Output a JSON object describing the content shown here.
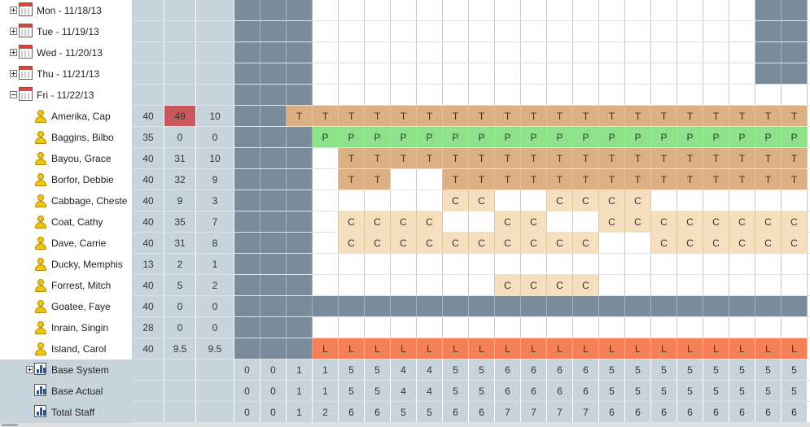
{
  "rows": [
    {
      "type": "day",
      "label": "Mon - 11/18/13",
      "expander": "plus",
      "cells": [
        "g",
        "g",
        "g",
        "",
        "",
        "",
        "",
        "",
        "",
        "",
        "",
        "",
        "",
        "",
        "",
        "",
        "",
        "",
        "",
        "",
        "g",
        "g"
      ]
    },
    {
      "type": "day",
      "label": "Tue - 11/19/13",
      "expander": "plus",
      "cells": [
        "g",
        "g",
        "g",
        "",
        "",
        "",
        "",
        "",
        "",
        "",
        "",
        "",
        "",
        "",
        "",
        "",
        "",
        "",
        "",
        "",
        "g",
        "g"
      ]
    },
    {
      "type": "day",
      "label": "Wed - 11/20/13",
      "expander": "plus",
      "cells": [
        "g",
        "g",
        "g",
        "",
        "",
        "",
        "",
        "",
        "",
        "",
        "",
        "",
        "",
        "",
        "",
        "",
        "",
        "",
        "",
        "",
        "g",
        "g"
      ]
    },
    {
      "type": "day",
      "label": "Thu - 11/21/13",
      "expander": "plus",
      "cells": [
        "g",
        "g",
        "g",
        "",
        "",
        "",
        "",
        "",
        "",
        "",
        "",
        "",
        "",
        "",
        "",
        "",
        "",
        "",
        "",
        "",
        "g",
        "g"
      ]
    },
    {
      "type": "day",
      "label": "Fri - 11/22/13",
      "expander": "minus",
      "cells": [
        "g",
        "g",
        "g",
        "",
        "",
        "",
        "",
        "",
        "",
        "",
        "",
        "",
        "",
        "",
        "",
        "",
        "",
        "",
        "",
        "",
        "",
        ""
      ]
    },
    {
      "type": "person",
      "label": "Amerika, Cap",
      "nums": [
        "40",
        "49",
        "10"
      ],
      "hi": 1,
      "cells": [
        "g",
        "g",
        "T",
        "T",
        "T",
        "T",
        "T",
        "T",
        "T",
        "T",
        "T",
        "T",
        "T",
        "T",
        "T",
        "T",
        "T",
        "T",
        "T",
        "T",
        "T",
        "T"
      ]
    },
    {
      "type": "person",
      "label": "Baggins, Bilbo",
      "nums": [
        "35",
        "0",
        "0"
      ],
      "cells": [
        "g",
        "g",
        "g",
        "P",
        "P",
        "P",
        "P",
        "P",
        "P",
        "P",
        "P",
        "P",
        "P",
        "P",
        "P",
        "P",
        "P",
        "P",
        "P",
        "P",
        "P",
        "P"
      ]
    },
    {
      "type": "person",
      "label": "Bayou, Grace",
      "nums": [
        "40",
        "31",
        "10"
      ],
      "cells": [
        "g",
        "g",
        "g",
        "",
        "T",
        "T",
        "T",
        "T",
        "T",
        "T",
        "T",
        "T",
        "T",
        "T",
        "T",
        "T",
        "T",
        "T",
        "T",
        "T",
        "T",
        "T"
      ]
    },
    {
      "type": "person",
      "label": "Borfor, Debbie",
      "nums": [
        "40",
        "32",
        "9"
      ],
      "cells": [
        "g",
        "g",
        "g",
        "",
        "T",
        "T",
        "",
        "",
        "T",
        "T",
        "T",
        "T",
        "T",
        "T",
        "T",
        "T",
        "T",
        "T",
        "T",
        "T",
        "T",
        "T"
      ]
    },
    {
      "type": "person",
      "label": "Cabbage, Cheste",
      "nums": [
        "40",
        "9",
        "3"
      ],
      "cells": [
        "g",
        "g",
        "g",
        "",
        "",
        "",
        "",
        "",
        "C",
        "C",
        "",
        "",
        "C",
        "C",
        "C",
        "C",
        "",
        "",
        "",
        "",
        "",
        ""
      ]
    },
    {
      "type": "person",
      "label": "Coat, Cathy",
      "nums": [
        "40",
        "35",
        "7"
      ],
      "cells": [
        "g",
        "g",
        "g",
        "",
        "C",
        "C",
        "C",
        "C",
        "",
        "",
        "C",
        "C",
        "",
        "",
        "C",
        "C",
        "C",
        "C",
        "C",
        "C",
        "C",
        "C"
      ]
    },
    {
      "type": "person",
      "label": "Dave, Carrie",
      "nums": [
        "40",
        "31",
        "8"
      ],
      "cells": [
        "g",
        "g",
        "g",
        "",
        "C",
        "C",
        "C",
        "C",
        "C",
        "C",
        "C",
        "C",
        "C",
        "C",
        "",
        "",
        "C",
        "C",
        "C",
        "C",
        "C",
        "C"
      ]
    },
    {
      "type": "person",
      "label": "Ducky, Memphis",
      "nums": [
        "13",
        "2",
        "1"
      ],
      "cells": [
        "g",
        "g",
        "g",
        "",
        "",
        "",
        "",
        "",
        "",
        "",
        "",
        "",
        "",
        "",
        "",
        "",
        "",
        "",
        "",
        "",
        "",
        ""
      ]
    },
    {
      "type": "person",
      "label": "Forrest, Mitch",
      "nums": [
        "40",
        "5",
        "2"
      ],
      "cells": [
        "g",
        "g",
        "g",
        "",
        "",
        "",
        "",
        "",
        "",
        "",
        "C",
        "C",
        "C",
        "C",
        "",
        "",
        "",
        "",
        "",
        "",
        "",
        ""
      ]
    },
    {
      "type": "person",
      "label": "Goatee, Faye",
      "nums": [
        "40",
        "0",
        "0"
      ],
      "cells": [
        "g",
        "g",
        "g",
        "g",
        "g",
        "g",
        "g",
        "g",
        "g",
        "g",
        "g",
        "g",
        "g",
        "g",
        "g",
        "g",
        "g",
        "g",
        "g",
        "g",
        "g",
        "g"
      ]
    },
    {
      "type": "person",
      "label": "Inrain, Singin",
      "nums": [
        "28",
        "0",
        "0"
      ],
      "cells": [
        "g",
        "g",
        "g",
        "",
        "",
        "",
        "",
        "",
        "",
        "",
        "",
        "",
        "",
        "",
        "",
        "",
        "",
        "",
        "",
        "",
        "",
        ""
      ]
    },
    {
      "type": "person",
      "label": "Island, Carol",
      "nums": [
        "40",
        "9.5",
        "9.5"
      ],
      "cells": [
        "g",
        "g",
        "g",
        "L",
        "L",
        "L",
        "L",
        "L",
        "L",
        "L",
        "L",
        "L",
        "L",
        "L",
        "L",
        "L",
        "L",
        "L",
        "L",
        "L",
        "L",
        "L"
      ]
    },
    {
      "type": "total",
      "label": "Base System",
      "expander": "plus",
      "values": [
        "0",
        "0",
        "1",
        "1",
        "5",
        "5",
        "4",
        "4",
        "5",
        "5",
        "6",
        "6",
        "6",
        "6",
        "5",
        "5",
        "5",
        "5",
        "5",
        "5",
        "5",
        "5"
      ]
    },
    {
      "type": "total",
      "label": "Base Actual",
      "values": [
        "0",
        "0",
        "1",
        "1",
        "5",
        "5",
        "4",
        "4",
        "5",
        "5",
        "6",
        "6",
        "6",
        "6",
        "5",
        "5",
        "5",
        "5",
        "5",
        "5",
        "5",
        "5"
      ]
    },
    {
      "type": "total",
      "label": "Total Staff",
      "values": [
        "0",
        "0",
        "1",
        "2",
        "6",
        "6",
        "5",
        "5",
        "6",
        "6",
        "7",
        "7",
        "7",
        "7",
        "6",
        "6",
        "6",
        "6",
        "6",
        "6",
        "6",
        "6"
      ]
    }
  ],
  "icons": {
    "day": "calendar-icon",
    "person": "person-icon",
    "total": "bar-chart-icon"
  },
  "colors": {
    "column_bg": "#c8d4dc",
    "gray": "#7a8b99",
    "T": "#ddb083",
    "P": "#8ee28a",
    "C": "#f6dfbd",
    "L": "#f58055",
    "over": "#c9585c"
  }
}
